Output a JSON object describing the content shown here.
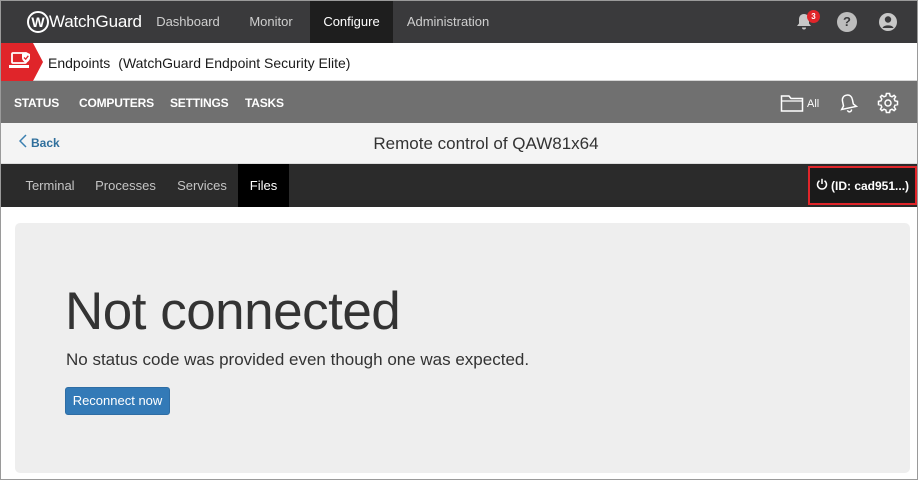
{
  "header": {
    "logo_text": "WatchGuard",
    "nav": [
      {
        "label": "Dashboard",
        "active": false
      },
      {
        "label": "Monitor",
        "active": false
      },
      {
        "label": "Configure",
        "active": true
      },
      {
        "label": "Administration",
        "active": false
      }
    ],
    "notification_count": "3",
    "help_glyph": "?"
  },
  "product": {
    "name": "Endpoints",
    "edition": "(WatchGuard Endpoint Security Elite)"
  },
  "sections": {
    "items": [
      "STATUS",
      "COMPUTERS",
      "SETTINGS",
      "TASKS"
    ],
    "filter_label": "All"
  },
  "titlebar": {
    "back_label": "Back",
    "title": "Remote control of QAW81x64"
  },
  "tabs": {
    "items": [
      {
        "label": "Terminal",
        "active": false
      },
      {
        "label": "Processes",
        "active": false
      },
      {
        "label": "Services",
        "active": false
      },
      {
        "label": "Files",
        "active": true
      }
    ],
    "session_id": "(ID: cad951...)"
  },
  "main": {
    "heading": "Not connected",
    "message": "No status code was provided even though one was expected.",
    "reconnect_label": "Reconnect now"
  },
  "colors": {
    "accent_red": "#e0252a",
    "primary_blue": "#337ab7",
    "topbar": "#3a3a3c",
    "sectionbar": "#707070"
  },
  "icons": [
    "bell-icon",
    "help-icon",
    "user-icon",
    "endpoint-shield-icon",
    "folder-icon",
    "alert-bell-icon",
    "gear-icon",
    "power-icon",
    "chevron-left-icon"
  ]
}
